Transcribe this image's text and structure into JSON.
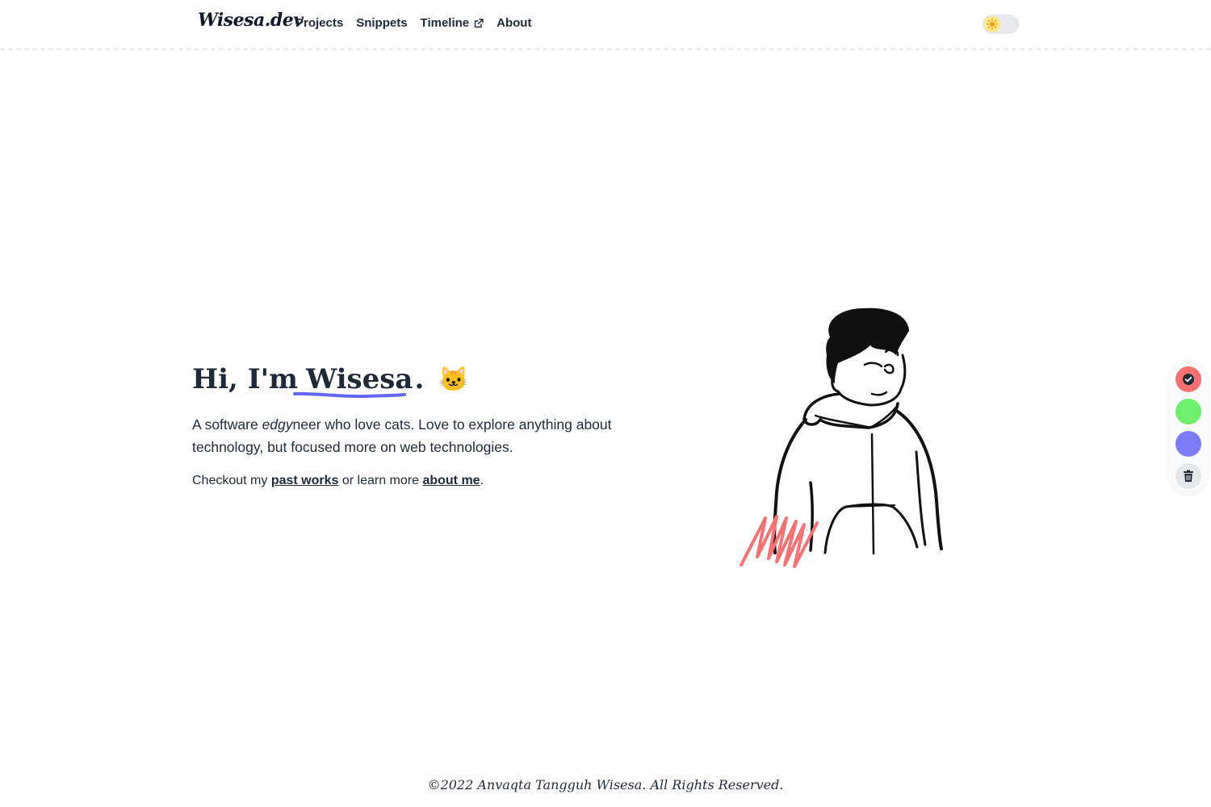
{
  "header": {
    "logo": "Wisesa.dev",
    "nav": [
      {
        "label": "Projects"
      },
      {
        "label": "Snippets"
      },
      {
        "label": "Timeline",
        "external": true
      },
      {
        "label": "About"
      }
    ],
    "theme_toggle": {
      "icon": "sun-icon",
      "mode": "light"
    }
  },
  "hero": {
    "greeting": "Hi, I'm",
    "name": "Wisesa",
    "period": ".",
    "emoji": "🐱",
    "intro_prefix": "A software ",
    "intro_emphasis": "edgy",
    "intro_suffix": "neer who love cats. Love to explore anything about technology, but focused more on web technologies.",
    "cta_prefix": "Checkout my ",
    "cta_link1": "past works",
    "cta_middle": " or learn more ",
    "cta_link2": "about me",
    "cta_suffix": "."
  },
  "palette": {
    "colors": [
      {
        "name": "red",
        "hex": "#f87171",
        "selected": true
      },
      {
        "name": "green",
        "hex": "#6ef06e",
        "selected": false
      },
      {
        "name": "blue",
        "hex": "#7c7cf8",
        "selected": false
      }
    ],
    "clear_icon": "trash-icon"
  },
  "colors": {
    "accent_underline": "#6366f1",
    "scribble": "#f87171"
  },
  "footer": {
    "text": "©2022 Anvaqta Tangguh Wisesa. All Rights Reserved."
  }
}
